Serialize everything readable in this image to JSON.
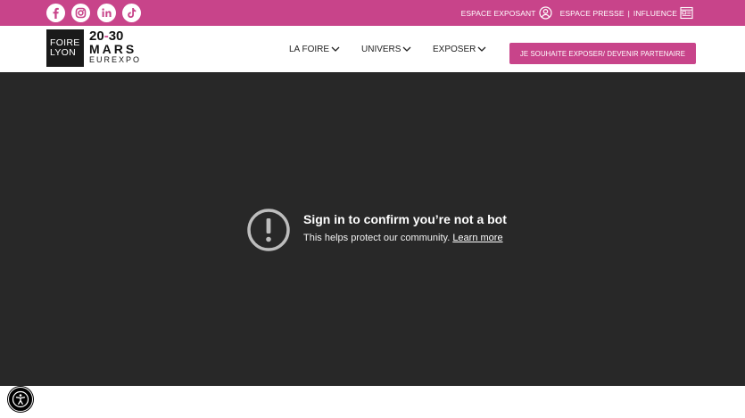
{
  "colors": {
    "brand_pink": "#c8448a",
    "video_background": "#282828",
    "logo_black": "#1a1a1a"
  },
  "topbar": {
    "social_icons": [
      "facebook-icon",
      "instagram-icon",
      "linkedin-icon",
      "tiktok-icon"
    ],
    "espace_exposant_label": "ESPACE EXPOSANT",
    "espace_presse_label": "ESPACE PRESSE",
    "separator": "|",
    "influence_label": "INFLUENCE"
  },
  "logo": {
    "line1": "FOIRE",
    "line2": "LYON",
    "dates_start": "20",
    "dates_dash": "-",
    "dates_end": "30",
    "month": "MARS",
    "venue": "EUREXPO"
  },
  "nav": {
    "items": [
      {
        "label": "LA FOIRE"
      },
      {
        "label": "UNIVERS"
      },
      {
        "label": "EXPOSER"
      }
    ],
    "cta_label": "JE SOUHAITE EXPOSER/ DEVENIR PARTENAIRE"
  },
  "video": {
    "title": "Sign in to confirm you’re not a bot",
    "body": "This helps protect our community.",
    "link_label": "Learn more"
  },
  "accessibility": {
    "icon": "accessibility-icon"
  }
}
